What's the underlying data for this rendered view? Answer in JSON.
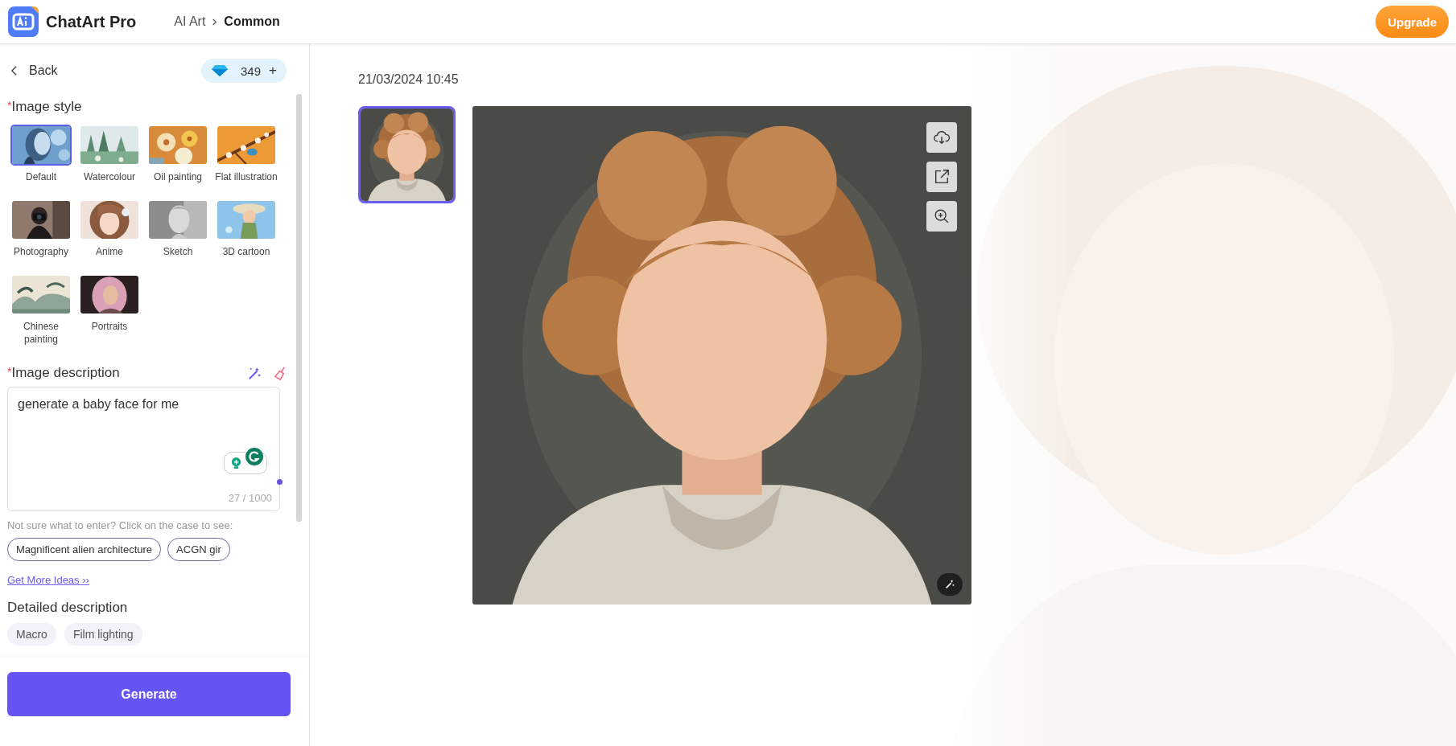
{
  "header": {
    "app_name": "ChatArt Pro",
    "breadcrumb": [
      "AI Art",
      "Common"
    ],
    "upgrade": "Upgrade"
  },
  "sidebar": {
    "back": "Back",
    "credits": "349",
    "credits_add": "+",
    "style_section": {
      "required_mark": "*",
      "title": "Image style",
      "styles": [
        {
          "label": "Default",
          "selected": true
        },
        {
          "label": "Watercolour",
          "selected": false
        },
        {
          "label": "Oil painting",
          "selected": false
        },
        {
          "label": "Flat illustration",
          "selected": false
        },
        {
          "label": "Photography",
          "selected": false
        },
        {
          "label": "Anime",
          "selected": false
        },
        {
          "label": "Sketch",
          "selected": false
        },
        {
          "label": "3D cartoon",
          "selected": false
        },
        {
          "label": "Chinese painting",
          "selected": false
        },
        {
          "label": "Portraits",
          "selected": false
        }
      ]
    },
    "description_section": {
      "required_mark": "*",
      "title": "Image description",
      "value": "generate a baby face for me",
      "counter": "27 / 1000",
      "hint": "Not sure what to enter? Click on the case to see:",
      "examples": [
        "Magnificent alien architecture",
        "ACGN gir"
      ],
      "more_link": "Get More Ideas ››"
    },
    "detailed_section": {
      "title": "Detailed description",
      "tags": [
        "Macro",
        "Film lighting"
      ]
    },
    "generate": "Generate"
  },
  "result": {
    "timestamp": "21/03/2024 10:45",
    "thumbnails": [
      {
        "selected": true
      }
    ]
  }
}
